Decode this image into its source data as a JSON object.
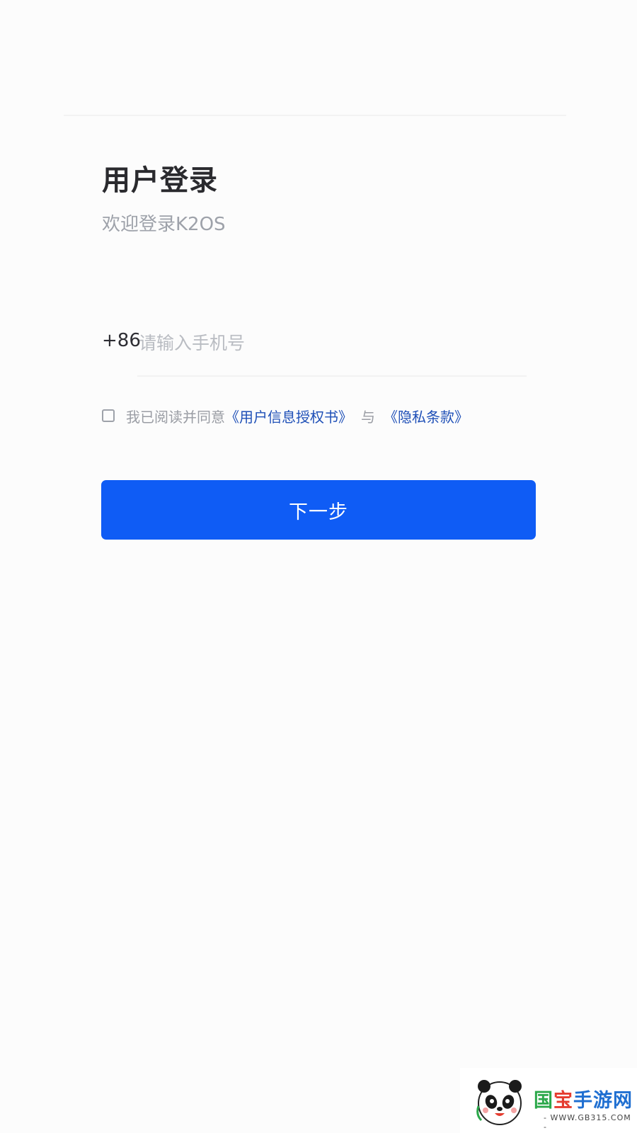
{
  "login": {
    "title": "用户登录",
    "subtitle": "欢迎登录K2OS",
    "phone": {
      "country_code": "+86",
      "placeholder": "请输入手机号",
      "value": ""
    },
    "agreement": {
      "checked": false,
      "prefix": "我已阅读并同意",
      "user_info_link": "《用户信息授权书》",
      "and": "与",
      "privacy_link": "《隐私条款》"
    },
    "next_button_label": "下一步",
    "colors": {
      "primary": "#0f5cf5",
      "link": "#1e4fb7",
      "title": "#2a2a2e",
      "muted": "#9ea2aa"
    }
  },
  "watermark": {
    "brand_part1": "国",
    "brand_part2": "宝",
    "brand_part3": "手游网",
    "site": "- WWW.GB315.COM -",
    "icon": "panda-logo-icon"
  }
}
